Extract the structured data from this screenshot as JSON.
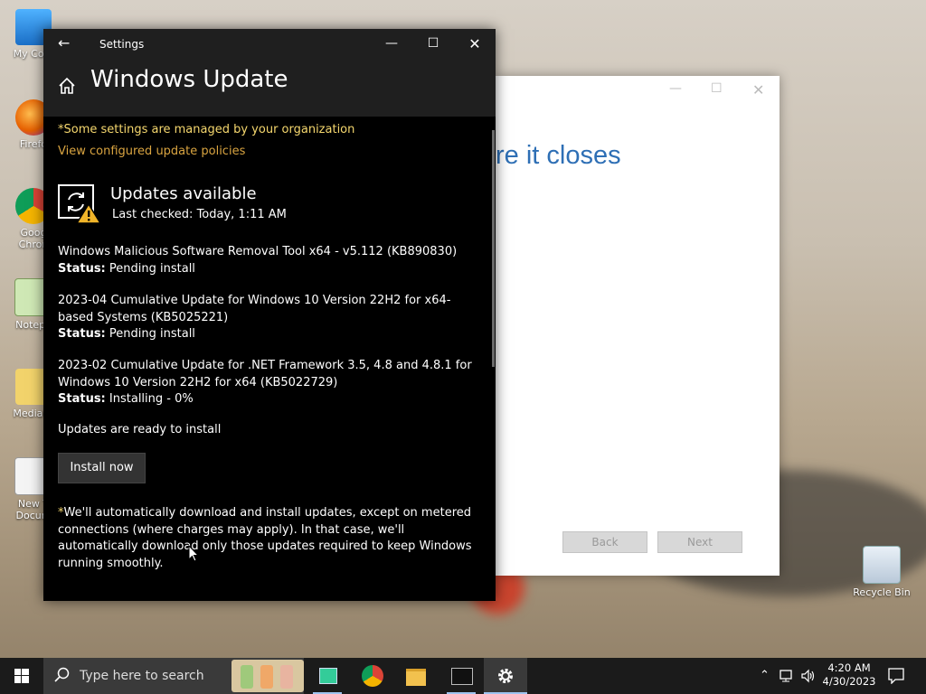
{
  "desktop": {
    "icons": [
      {
        "label": "My Com"
      },
      {
        "label": "Firefo"
      },
      {
        "label": "Goog\nChron"
      },
      {
        "label": "Notepa"
      },
      {
        "label": "MediaCr"
      },
      {
        "label": "New T\nDocum"
      },
      {
        "label": "Recycle Bin"
      }
    ]
  },
  "wizard": {
    "heading_partial": "re it closes",
    "back_label": "Back",
    "next_label": "Next"
  },
  "settings": {
    "window_title": "Settings",
    "page_title": "Windows Update",
    "managed_notice": "*Some settings are managed by your organization",
    "policies_link": "View configured update policies",
    "status_title": "Updates available",
    "last_checked": "Last checked: Today, 1:11 AM",
    "updates": [
      {
        "name": "Windows Malicious Software Removal Tool x64 - v5.112 (KB890830)",
        "status_label": "Status:",
        "status": "Pending install"
      },
      {
        "name": "2023-04 Cumulative Update for Windows 10 Version 22H2 for x64-based Systems (KB5025221)",
        "status_label": "Status:",
        "status": "Pending install"
      },
      {
        "name": "2023-02 Cumulative Update for .NET Framework 3.5, 4.8 and 4.8.1 for Windows 10 Version 22H2 for x64 (KB5022729)",
        "status_label": "Status:",
        "status": "Installing - 0%"
      }
    ],
    "ready_text": "Updates are ready to install",
    "install_button": "Install now",
    "note_star": "*",
    "note_text": "We'll automatically download and install updates, except on metered connections (where charges may apply). In that case, we'll automatically download only those updates required to keep Windows running smoothly."
  },
  "taskbar": {
    "search_placeholder": "Type here to search",
    "time": "4:20 AM",
    "date": "4/30/2023"
  },
  "colors": {
    "notice_yellow": "#f5d76e",
    "link_orange": "#d9a441",
    "accent_blue": "#2e6fb5"
  }
}
